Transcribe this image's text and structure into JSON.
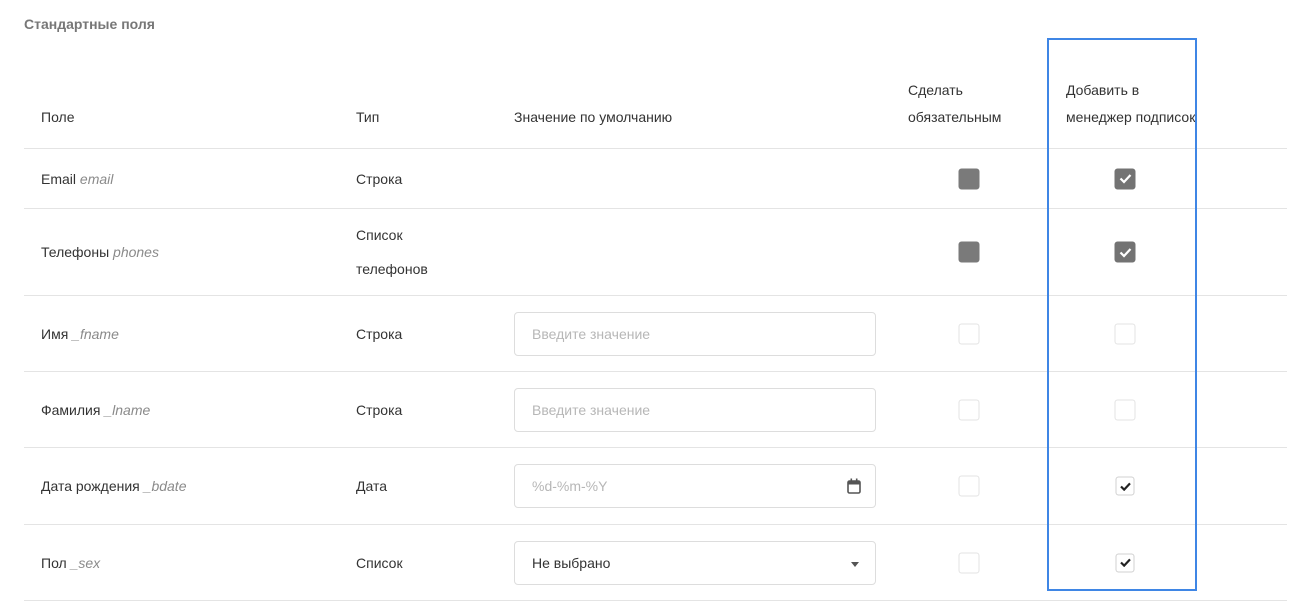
{
  "section_title": "Стандартные поля",
  "columns": {
    "field": "Поле",
    "type": "Тип",
    "default": "Значение по умолчанию",
    "required": "Сделать обязательным",
    "manager": "Добавить в менеджер подписок"
  },
  "placeholder_text": "Введите значение",
  "rows": [
    {
      "label": "Email",
      "key": "email",
      "type": "Строка",
      "default": null,
      "required": "filled",
      "manager": "checked-dark"
    },
    {
      "label": "Телефоны",
      "key": "phones",
      "type": "Список телефонов",
      "default": null,
      "required": "filled",
      "manager": "checked-dark"
    },
    {
      "label": "Имя",
      "key": "_fname",
      "type": "Строка",
      "default": {
        "kind": "text",
        "placeholder": "Введите значение"
      },
      "required": "empty",
      "manager": "empty"
    },
    {
      "label": "Фамилия",
      "key": "_lname",
      "type": "Строка",
      "default": {
        "kind": "text",
        "placeholder": "Введите значение"
      },
      "required": "empty",
      "manager": "empty"
    },
    {
      "label": "Дата рождения",
      "key": "_bdate",
      "type": "Дата",
      "default": {
        "kind": "date",
        "placeholder": "%d-%m-%Y"
      },
      "required": "empty",
      "manager": "checked-light"
    },
    {
      "label": "Пол",
      "key": "_sex",
      "type": "Список",
      "default": {
        "kind": "select",
        "value": "Не выбрано"
      },
      "required": "empty",
      "manager": "checked-light"
    }
  ],
  "colors": {
    "highlight": "#3f86e5",
    "checkbox_dark": "#737373"
  },
  "icons": {
    "date": "calendar-icon",
    "select": "caret-down-icon",
    "check": "check-icon"
  }
}
